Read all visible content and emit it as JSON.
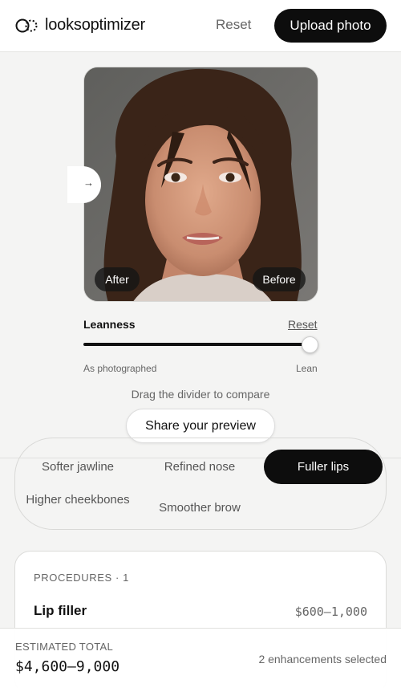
{
  "header": {
    "brand": "looksoptimizer",
    "reset_label": "Reset",
    "upload_label": "Upload photo"
  },
  "compare": {
    "after_label": "After",
    "before_label": "Before",
    "handle_icon": "arrow-right-icon",
    "hint": "Drag the divider to compare",
    "share_label": "Share your preview"
  },
  "slider": {
    "label": "Leanness",
    "reset_label": "Reset",
    "min_label": "As photographed",
    "max_label": "Lean",
    "value": 1.0
  },
  "enhancements": {
    "chips": [
      {
        "label": "Softer jawline",
        "selected": false
      },
      {
        "label": "Refined nose",
        "selected": false
      },
      {
        "label": "Fuller lips",
        "selected": true
      },
      {
        "label": "Higher cheekbones",
        "selected": false
      },
      {
        "label": "Smoother brow",
        "selected": false
      }
    ]
  },
  "procedures": {
    "header": "PROCEDURES · 1",
    "items": [
      {
        "name": "Lip filler",
        "price": "$600–1,000"
      }
    ]
  },
  "summary": {
    "total_label": "ESTIMATED TOTAL",
    "total_value": "$4,600–9,000",
    "selected_text": "2 enhancements selected"
  },
  "colors": {
    "accent": "#0d0d0d",
    "background": "#f4f4f3",
    "muted_text": "#666666"
  }
}
